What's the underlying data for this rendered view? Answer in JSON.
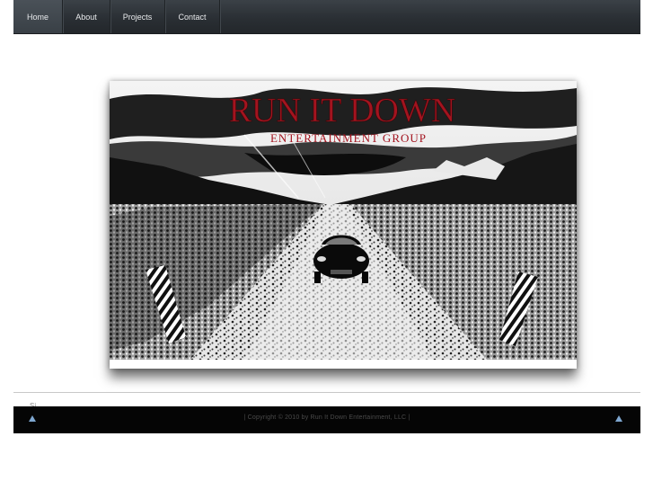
{
  "nav": {
    "items": [
      {
        "label": "Home"
      },
      {
        "label": "About"
      },
      {
        "label": "Projects"
      },
      {
        "label": "Contact"
      }
    ],
    "active_index": 0
  },
  "banner": {
    "title": "RUN IT DOWN",
    "subtitle": "ENTERTAINMENT GROUP",
    "title_color": "#a3141f"
  },
  "content": {
    "clipped_text": "Si"
  },
  "footer": {
    "copyright": "| Copyright © 2010 by Run It Down Entertainment, LLC |",
    "arrow_color": "#7fa7d0"
  }
}
